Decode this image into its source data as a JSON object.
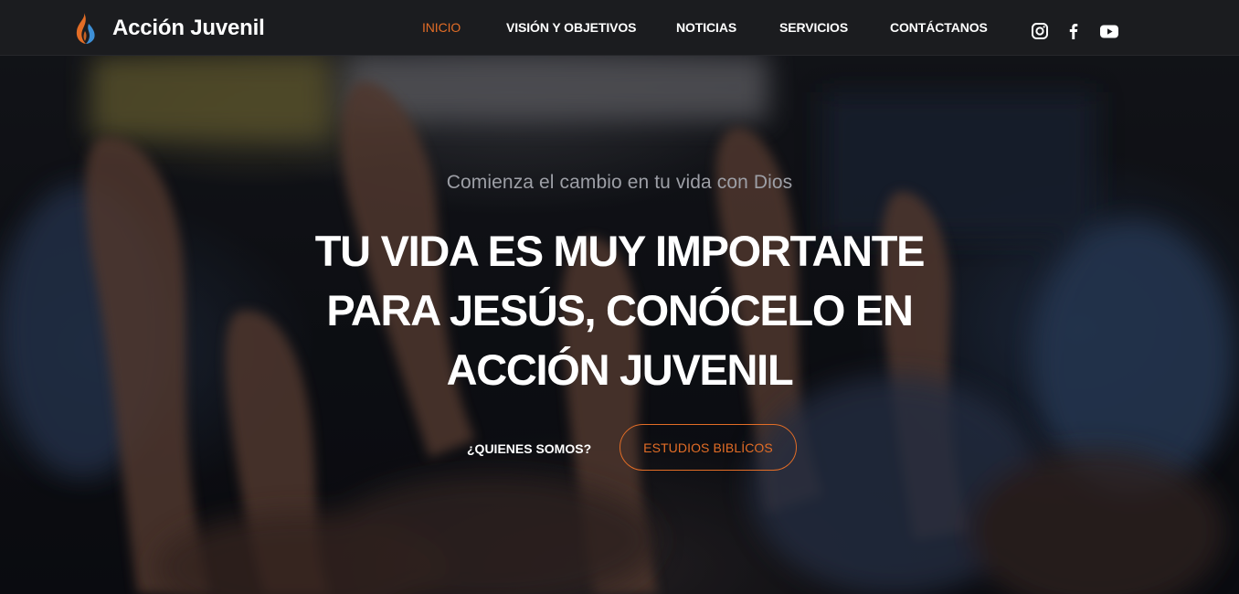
{
  "header": {
    "brand_name": "Acción Juvenil",
    "nav": [
      {
        "label": "INICIO",
        "active": true
      },
      {
        "label": "VISIÓN Y OBJETIVOS",
        "active": false
      },
      {
        "label": "NOTICIAS",
        "active": false
      },
      {
        "label": "SERVICIOS",
        "active": false
      },
      {
        "label": "CONTÁCTANOS",
        "active": false
      }
    ],
    "social_icons": [
      "instagram-icon",
      "facebook-icon",
      "youtube-icon"
    ]
  },
  "hero": {
    "subtitle": "Comienza el cambio en tu vida con Dios",
    "title_lines": [
      "TU VIDA ES MUY IMPORTANTE",
      "PARA JESÚS, CONÓCELO EN",
      "ACCIÓN JUVENIL"
    ],
    "about_label": "¿QUIENES SOMOS?",
    "bible_label": "ESTUDIOS BIBLÍCOS"
  },
  "colors": {
    "accent": "#e36d26",
    "navbar_bg": "#1b1c1f",
    "text_primary": "#ffffff",
    "subtitle_text": "#9d9fa6",
    "logo_blue": "#3d8fd6"
  }
}
